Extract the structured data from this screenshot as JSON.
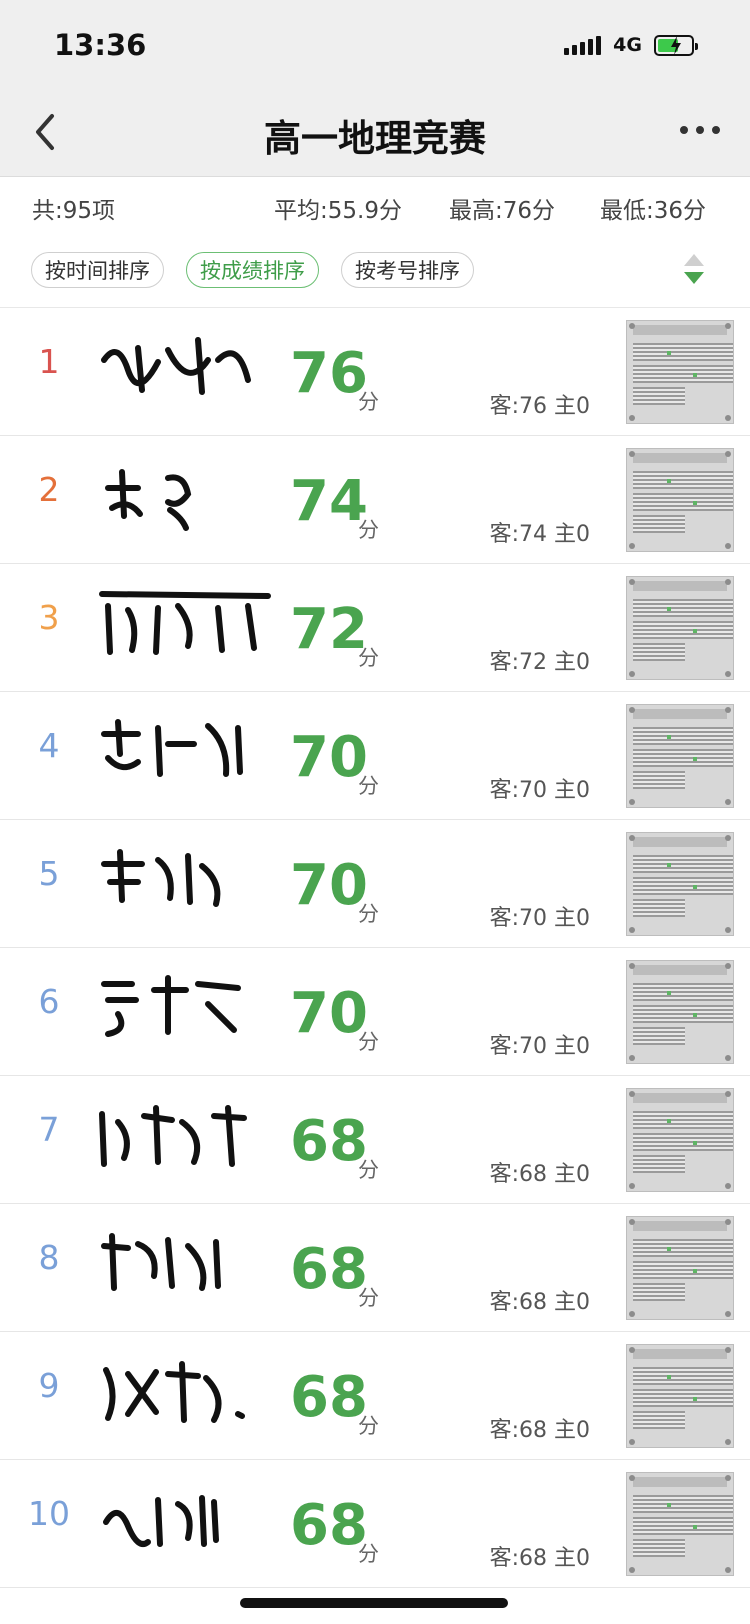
{
  "status_bar": {
    "time": "13:36",
    "network": "4G"
  },
  "nav": {
    "title": "高一地理竞赛"
  },
  "stats": {
    "total": "共:95项",
    "average": "平均:55.9分",
    "highest": "最高:76分",
    "lowest": "最低:36分"
  },
  "sort": {
    "by_time": "按时间排序",
    "by_score": "按成绩排序",
    "by_exam_no": "按考号排序",
    "active": "by_score"
  },
  "colors": {
    "accent": "#4aa44f",
    "rank1": "#d9534f",
    "rank2": "#e4703a",
    "rank3": "#f0a04b",
    "rank_other": "#7aa0d8"
  },
  "students": [
    {
      "rank": "1",
      "score": "76",
      "unit": "分",
      "detail": "客:76 主0"
    },
    {
      "rank": "2",
      "score": "74",
      "unit": "分",
      "detail": "客:74 主0"
    },
    {
      "rank": "3",
      "score": "72",
      "unit": "分",
      "detail": "客:72 主0"
    },
    {
      "rank": "4",
      "score": "70",
      "unit": "分",
      "detail": "客:70 主0"
    },
    {
      "rank": "5",
      "score": "70",
      "unit": "分",
      "detail": "客:70 主0"
    },
    {
      "rank": "6",
      "score": "70",
      "unit": "分",
      "detail": "客:70 主0"
    },
    {
      "rank": "7",
      "score": "68",
      "unit": "分",
      "detail": "客:68 主0"
    },
    {
      "rank": "8",
      "score": "68",
      "unit": "分",
      "detail": "客:68 主0"
    },
    {
      "rank": "9",
      "score": "68",
      "unit": "分",
      "detail": "客:68 主0"
    },
    {
      "rank": "10",
      "score": "68",
      "unit": "分",
      "detail": "客:68 主0"
    }
  ]
}
